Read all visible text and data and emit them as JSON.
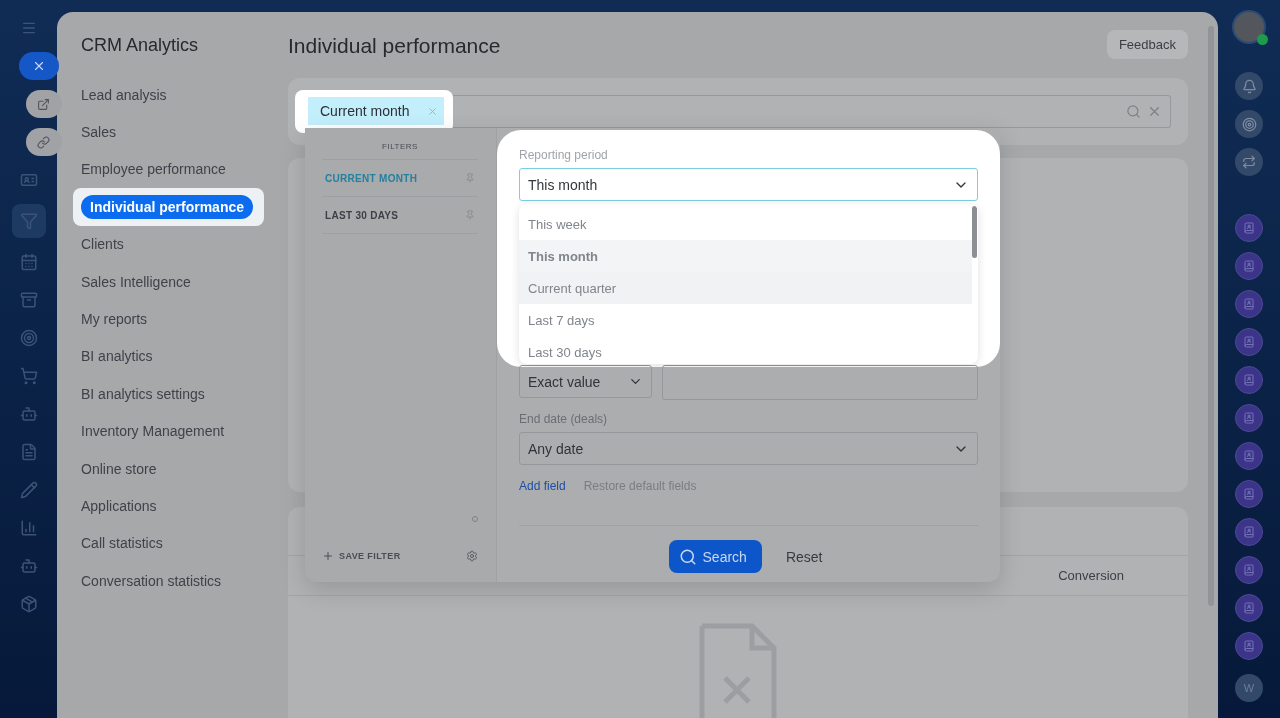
{
  "nav": {
    "title": "CRM Analytics",
    "items": [
      {
        "label": "Lead analysis",
        "selected": false
      },
      {
        "label": "Sales",
        "selected": false
      },
      {
        "label": "Employee performance",
        "selected": false
      },
      {
        "label": "Individual performance",
        "selected": true
      },
      {
        "label": "Clients",
        "selected": false
      },
      {
        "label": "Sales Intelligence",
        "selected": false
      },
      {
        "label": "My reports",
        "selected": false
      },
      {
        "label": "BI analytics",
        "selected": false
      },
      {
        "label": "BI analytics settings",
        "selected": false
      },
      {
        "label": "Inventory Management",
        "selected": false
      },
      {
        "label": "Online store",
        "selected": false
      },
      {
        "label": "Applications",
        "selected": false
      },
      {
        "label": "Call statistics",
        "selected": false
      },
      {
        "label": "Conversation statistics",
        "selected": false
      }
    ]
  },
  "page": {
    "title": "Individual performance",
    "feedback": "Feedback"
  },
  "search": {
    "chip": "Current month"
  },
  "filter_popup": {
    "heading": "FILTERS",
    "presets": [
      {
        "label": "CURRENT MONTH",
        "selected": true
      },
      {
        "label": "LAST 30 DAYS",
        "selected": false
      }
    ],
    "save_filter": "SAVE FILTER",
    "reporting_period": {
      "label": "Reporting period",
      "value": "This month",
      "expanded": true,
      "options": [
        {
          "label": "This week",
          "selected": false,
          "hovered": false
        },
        {
          "label": "This month",
          "selected": true,
          "hovered": false
        },
        {
          "label": "Current quarter",
          "selected": false,
          "hovered": true
        },
        {
          "label": "Last 7 days",
          "selected": false,
          "hovered": false
        },
        {
          "label": "Last 30 days",
          "selected": false,
          "hovered": false
        }
      ]
    },
    "amount": {
      "mode": "Exact value"
    },
    "end_date": {
      "label": "End date (deals)",
      "value": "Any date"
    },
    "add_field": "Add field",
    "restore_fields": "Restore default fields",
    "search_button": "Search",
    "reset_button": "Reset"
  },
  "table": {
    "columns": [
      {
        "label": "Conversion"
      }
    ]
  },
  "right_rail": {
    "bottom_badge": "W"
  }
}
